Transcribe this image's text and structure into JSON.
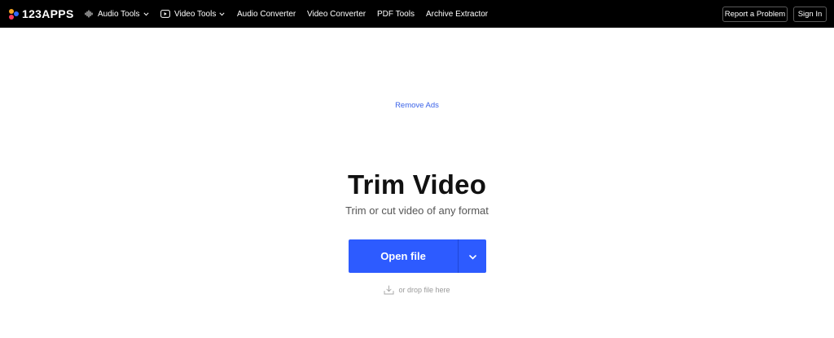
{
  "brand": {
    "name": "123APPS"
  },
  "nav": {
    "items": [
      {
        "label": "Audio Tools",
        "icon": "audio-wave-icon",
        "has_dropdown": true
      },
      {
        "label": "Video Tools",
        "icon": "play-icon",
        "has_dropdown": true
      },
      {
        "label": "Audio Converter"
      },
      {
        "label": "Video Converter"
      },
      {
        "label": "PDF Tools"
      },
      {
        "label": "Archive Extractor"
      }
    ],
    "report_label": "Report a Problem",
    "signin_label": "Sign In"
  },
  "main": {
    "remove_ads": "Remove Ads",
    "title": "Trim Video",
    "subtitle": "Trim or cut video of any format",
    "open_file_label": "Open file",
    "drop_hint": "or drop file here"
  },
  "colors": {
    "topbar": "#000000",
    "accent": "#2d5bff",
    "link": "#3b63e8"
  }
}
